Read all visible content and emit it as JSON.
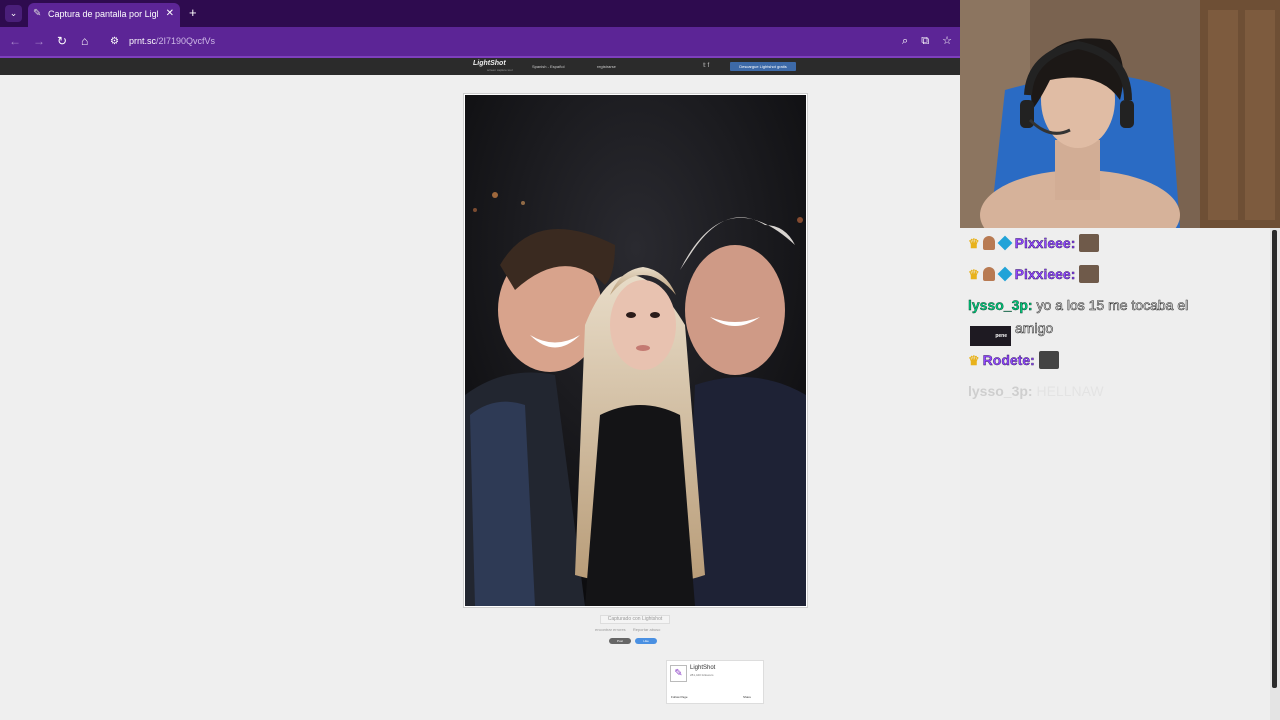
{
  "browser": {
    "tab_title": "Captura de pantalla por Lightshot",
    "url_domain": "prnt.sc",
    "url_path": "/2I7190QvcfVs"
  },
  "lightshot": {
    "logo": "LightShot",
    "logo_sub": "screen capture tool",
    "language": "Spanish - Español",
    "register": "registrarse",
    "download_button": "Descargue Lightshot gratis",
    "captured_with": "Capturado con Lightshot",
    "link_found_it": "encontrar errores",
    "link_report": "Reportar abuso",
    "post_button": "Post",
    "like_button": "Like",
    "fb_name": "LightShot",
    "fb_count": "281,440 followers",
    "fb_follow": "Follow Page",
    "fb_share": "Share"
  },
  "chat": {
    "messages": [
      {
        "user": "Pixxieee:",
        "text": "",
        "color": "#9147ff",
        "badges": [
          "crown-icon",
          "person-icon",
          "cube-icon"
        ]
      },
      {
        "user": "Pixxieee:",
        "text": "",
        "color": "#9147ff",
        "badges": [
          "crown-icon",
          "person-icon",
          "cube-icon"
        ]
      },
      {
        "user": "lysso_3p:",
        "text": "yo a los 15 me tocaba el",
        "text2": "amigo",
        "emote_label": "pene",
        "color": "#00c77a"
      },
      {
        "user": "Rodete:",
        "text": "",
        "color": "#9147ff",
        "badges": [
          "crown-icon"
        ]
      },
      {
        "user": "lysso_3p:",
        "text": "HELLNAW",
        "color": "#00c77a"
      }
    ]
  }
}
